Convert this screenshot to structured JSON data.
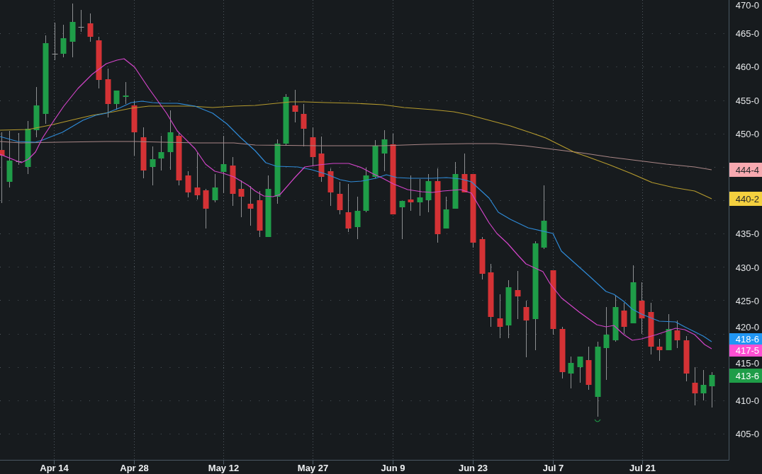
{
  "chart": {
    "price_axis_labels": [
      "470-0",
      "465-0",
      "460-0",
      "455-0",
      "450-0",
      "435-0",
      "430-0",
      "425-0",
      "420-0",
      "415-0",
      "410-0",
      "405-0"
    ],
    "price_tags": [
      {
        "text": "444-4",
        "color": "#f7a9b0"
      },
      {
        "text": "440-2",
        "color": "#f4d03f"
      },
      {
        "text": "418-6",
        "color": "#2196f3"
      },
      {
        "text": "417-5",
        "color": "#ff4fd2"
      },
      {
        "text": "413-6",
        "color": "#1f9d48"
      }
    ],
    "date_axis_labels": [
      "Apr 14",
      "Apr 28",
      "May 12",
      "May 27",
      "Jun 9",
      "Jun 23",
      "Jul 7",
      "Jul 21"
    ]
  }
}
